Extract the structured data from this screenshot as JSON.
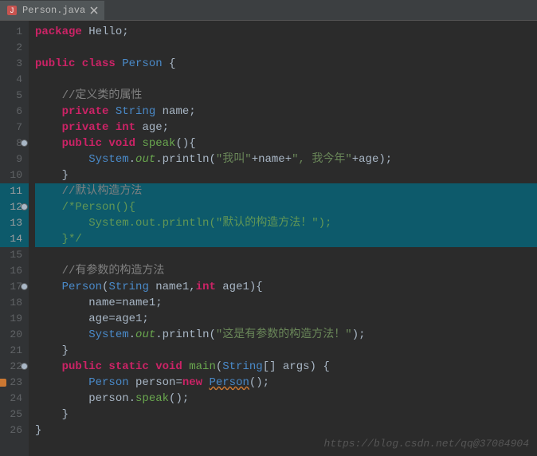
{
  "tab": {
    "filename": "Person.java",
    "close_tooltip": "Close"
  },
  "lines": [
    {
      "n": 1,
      "tokens": [
        {
          "t": "package ",
          "c": "kw"
        },
        {
          "t": "Hello;",
          "c": "ident"
        }
      ]
    },
    {
      "n": 2,
      "tokens": []
    },
    {
      "n": 3,
      "tokens": [
        {
          "t": "public class ",
          "c": "kw"
        },
        {
          "t": "Person ",
          "c": "type"
        },
        {
          "t": "{",
          "c": "brace"
        }
      ]
    },
    {
      "n": 4,
      "tokens": []
    },
    {
      "n": 5,
      "tokens": [
        {
          "t": "    ",
          "c": ""
        },
        {
          "t": "//定义类的属性",
          "c": "comment"
        }
      ]
    },
    {
      "n": 6,
      "tokens": [
        {
          "t": "    ",
          "c": ""
        },
        {
          "t": "private ",
          "c": "kw"
        },
        {
          "t": "String ",
          "c": "type"
        },
        {
          "t": "name;",
          "c": "ident"
        }
      ]
    },
    {
      "n": 7,
      "tokens": [
        {
          "t": "    ",
          "c": ""
        },
        {
          "t": "private int ",
          "c": "kw"
        },
        {
          "t": "age;",
          "c": "ident"
        }
      ]
    },
    {
      "n": 8,
      "fold": true,
      "tokens": [
        {
          "t": "    ",
          "c": ""
        },
        {
          "t": "public void ",
          "c": "kw"
        },
        {
          "t": "speak",
          "c": "method"
        },
        {
          "t": "(){",
          "c": "brace"
        }
      ]
    },
    {
      "n": 9,
      "tokens": [
        {
          "t": "        ",
          "c": ""
        },
        {
          "t": "System",
          "c": "type"
        },
        {
          "t": ".",
          "c": "punct"
        },
        {
          "t": "out",
          "c": "static-f"
        },
        {
          "t": ".",
          "c": "punct"
        },
        {
          "t": "println",
          "c": "ident"
        },
        {
          "t": "(",
          "c": "brace"
        },
        {
          "t": "\"我叫\"",
          "c": "str"
        },
        {
          "t": "+name+",
          "c": "ident"
        },
        {
          "t": "\", 我今年\"",
          "c": "str"
        },
        {
          "t": "+age);",
          "c": "ident"
        }
      ]
    },
    {
      "n": 10,
      "tokens": [
        {
          "t": "    }",
          "c": "brace"
        }
      ]
    },
    {
      "n": 11,
      "hl": true,
      "tokens": [
        {
          "t": "    ",
          "c": ""
        },
        {
          "t": "//默认构造方法",
          "c": "comment"
        }
      ]
    },
    {
      "n": 12,
      "hl": true,
      "fold": true,
      "tokens": [
        {
          "t": "    ",
          "c": ""
        },
        {
          "t": "/*Person(){",
          "c": "comment-c"
        }
      ]
    },
    {
      "n": 13,
      "hl": true,
      "tokens": [
        {
          "t": "        ",
          "c": ""
        },
        {
          "t": "System.out.println(\"默认的构造方法！\");",
          "c": "comment-c"
        }
      ]
    },
    {
      "n": 14,
      "hl": true,
      "tokens": [
        {
          "t": "    }*/",
          "c": "comment-c"
        }
      ]
    },
    {
      "n": 15,
      "tokens": []
    },
    {
      "n": 16,
      "tokens": [
        {
          "t": "    ",
          "c": ""
        },
        {
          "t": "//有参数的构造方法",
          "c": "comment"
        }
      ]
    },
    {
      "n": 17,
      "fold": true,
      "tokens": [
        {
          "t": "    ",
          "c": ""
        },
        {
          "t": "Person",
          "c": "type2"
        },
        {
          "t": "(",
          "c": "brace"
        },
        {
          "t": "String ",
          "c": "type"
        },
        {
          "t": "name1",
          "c": "param"
        },
        {
          "t": ",",
          "c": "punct"
        },
        {
          "t": "int ",
          "c": "kw"
        },
        {
          "t": "age1",
          "c": "param"
        },
        {
          "t": "){",
          "c": "brace"
        }
      ]
    },
    {
      "n": 18,
      "tokens": [
        {
          "t": "        name=name1;",
          "c": "ident"
        }
      ]
    },
    {
      "n": 19,
      "tokens": [
        {
          "t": "        age=age1;",
          "c": "ident"
        }
      ]
    },
    {
      "n": 20,
      "tokens": [
        {
          "t": "        ",
          "c": ""
        },
        {
          "t": "System",
          "c": "type"
        },
        {
          "t": ".",
          "c": "punct"
        },
        {
          "t": "out",
          "c": "static-f"
        },
        {
          "t": ".",
          "c": "punct"
        },
        {
          "t": "println",
          "c": "ident"
        },
        {
          "t": "(",
          "c": "brace"
        },
        {
          "t": "\"这是有参数的构造方法！\"",
          "c": "str"
        },
        {
          "t": ");",
          "c": "ident"
        }
      ]
    },
    {
      "n": 21,
      "tokens": [
        {
          "t": "    }",
          "c": "brace"
        }
      ]
    },
    {
      "n": 22,
      "fold": true,
      "tokens": [
        {
          "t": "    ",
          "c": ""
        },
        {
          "t": "public static void ",
          "c": "kw"
        },
        {
          "t": "main",
          "c": "method"
        },
        {
          "t": "(",
          "c": "brace"
        },
        {
          "t": "String",
          "c": "type"
        },
        {
          "t": "[] ",
          "c": "brace"
        },
        {
          "t": "args",
          "c": "param"
        },
        {
          "t": ") {",
          "c": "brace"
        }
      ]
    },
    {
      "n": 23,
      "warn": true,
      "tokens": [
        {
          "t": "        ",
          "c": ""
        },
        {
          "t": "Person ",
          "c": "type2"
        },
        {
          "t": "person",
          "c": "ident"
        },
        {
          "t": "=",
          "c": "punct"
        },
        {
          "t": "new ",
          "c": "new-kw"
        },
        {
          "t": "Person",
          "c": "type2 underline-wavy"
        },
        {
          "t": "();",
          "c": "brace"
        }
      ]
    },
    {
      "n": 24,
      "tokens": [
        {
          "t": "        person.",
          "c": "ident"
        },
        {
          "t": "speak",
          "c": "method"
        },
        {
          "t": "();",
          "c": "brace"
        }
      ]
    },
    {
      "n": 25,
      "tokens": [
        {
          "t": "    }",
          "c": "brace"
        }
      ]
    },
    {
      "n": 26,
      "tokens": [
        {
          "t": "}",
          "c": "brace"
        }
      ]
    }
  ],
  "watermark": "https://blog.csdn.net/qq@37084904"
}
